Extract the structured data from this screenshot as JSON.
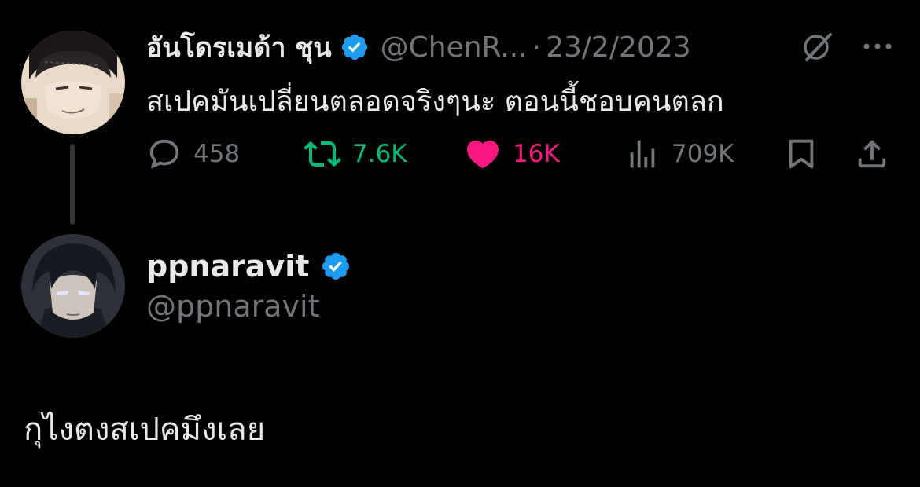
{
  "tweet": {
    "author": {
      "display_name": "อันโดรเมด้า ชุน",
      "handle": "@ChenR...",
      "verified": true,
      "avatar": "anime-character-avatar"
    },
    "separator": "·",
    "date": "23/2/2023",
    "text": "สเปคมันเปลี่ยนตลอดจริงๆนะ ตอนนี้ชอบคนตลก",
    "metrics": {
      "replies": "458",
      "retweets": "7.6K",
      "likes": "16K",
      "views": "709K"
    },
    "liked": true,
    "icons": {
      "grok": "grok-icon",
      "more": "more-icon",
      "reply": "reply-icon",
      "retweet": "retweet-icon",
      "like": "heart-icon",
      "views": "views-icon",
      "bookmark": "bookmark-icon",
      "share": "share-icon"
    }
  },
  "reply": {
    "author": {
      "display_name": "ppnaravit",
      "handle": "@ppnaravit",
      "verified": true,
      "avatar": "anime-character-avatar"
    },
    "text": "กุไงตงสเปคมึงเลย"
  },
  "colors": {
    "background": "#000000",
    "text": "#e7e9ea",
    "secondary": "#71767b",
    "verified": "#1d9bf0",
    "retweet": "#00ba7c",
    "like": "#f91880"
  }
}
